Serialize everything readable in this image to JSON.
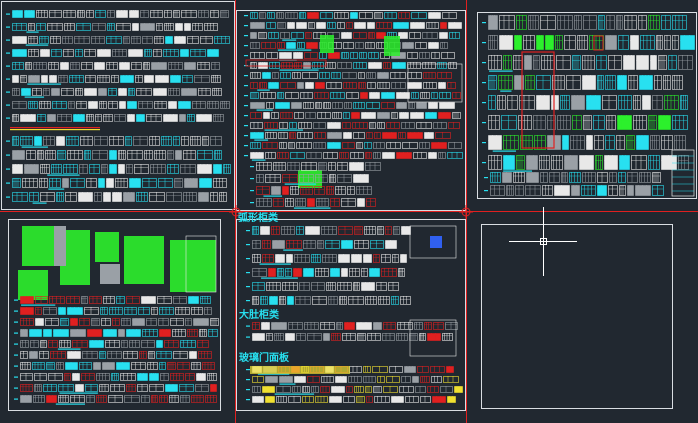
{
  "colors": {
    "background": "#212830",
    "border": "#d9dde2",
    "cyan": "#28e0f0",
    "green": "#2cf02c",
    "red": "#e02020",
    "white": "#e8e8e8",
    "gray": "#9aa0a6",
    "yellow": "#f0e030",
    "blue": "#3060f0",
    "darkred": "#a01818"
  },
  "sheet_labels": {
    "arc_cabinets": "弧形柜类",
    "large_cabinets": "大肚柜类",
    "glass_door_panels": "玻璃门面板"
  },
  "icons": {
    "crosshair_cursor": "crosshair-icon",
    "origin_marker_left": "origin-marker-icon",
    "origin_marker_right": "origin-marker-icon"
  }
}
